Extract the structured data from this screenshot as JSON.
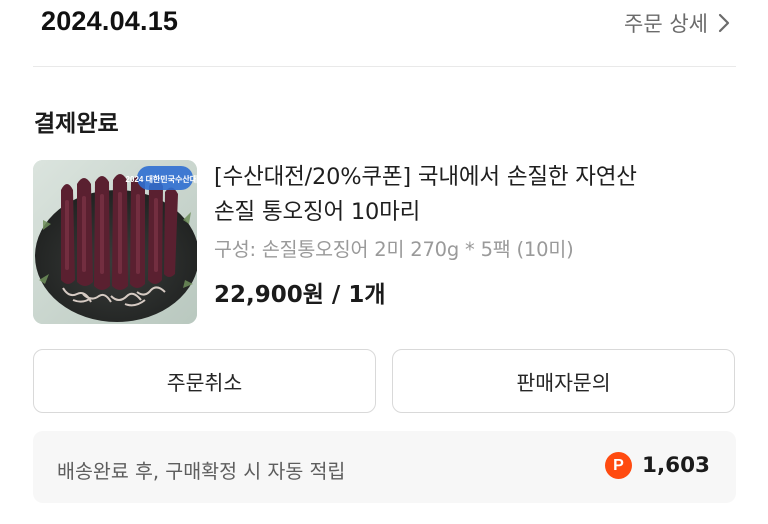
{
  "order": {
    "date": "2024.04.15",
    "detail_label": "주문 상세",
    "status": "결제완료"
  },
  "product": {
    "name_line1": "[수산대전/20%쿠폰] 국내에서 손질한 자연산",
    "name_line2": "손질 통오징어 10마리",
    "option": "구성: 손질통오징어 2미 270g * 5팩 (10미)",
    "price": "22,900원 / 1개",
    "thumb_badge": "2024 대한민국수산대전"
  },
  "actions": {
    "cancel_label": "주문취소",
    "inquiry_label": "판매자문의"
  },
  "points": {
    "description": "배송완료 후, 구매확정 시 자동 적립",
    "badge": "P",
    "value": "1,603"
  },
  "colors": {
    "point_accent": "#ff4b10",
    "muted_text": "#9a9a9a",
    "border": "#d9d9d9"
  }
}
